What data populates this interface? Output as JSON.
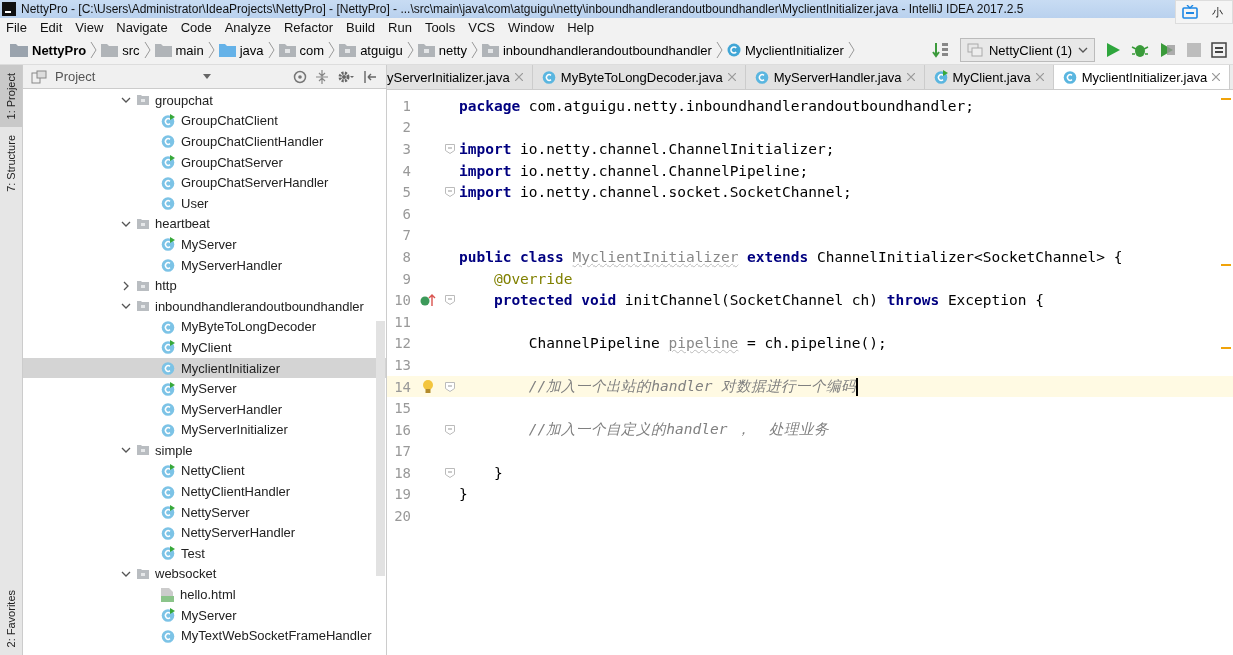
{
  "window": {
    "title": "NettyPro - [C:\\Users\\Administrator\\IdeaProjects\\NettyPro] - [NettyPro] - ...\\src\\main\\java\\com\\atguigu\\netty\\inboundhandlerandoutboundhandler\\MyclientInitializer.java - IntelliJ IDEA 2017.2.5"
  },
  "overlay_widget": {
    "label": "小"
  },
  "menu": [
    "File",
    "Edit",
    "View",
    "Navigate",
    "Code",
    "Analyze",
    "Refactor",
    "Build",
    "Run",
    "Tools",
    "VCS",
    "Window",
    "Help"
  ],
  "breadcrumbs": [
    {
      "label": "NettyPro",
      "kind": "project"
    },
    {
      "label": "src",
      "kind": "folder"
    },
    {
      "label": "main",
      "kind": "folder"
    },
    {
      "label": "java",
      "kind": "source"
    },
    {
      "label": "com",
      "kind": "package"
    },
    {
      "label": "atguigu",
      "kind": "package"
    },
    {
      "label": "netty",
      "kind": "package"
    },
    {
      "label": "inboundhandlerandoutboundhandler",
      "kind": "package"
    },
    {
      "label": "MyclientInitializer",
      "kind": "class"
    }
  ],
  "run_config": {
    "label": "NettyClient (1)"
  },
  "side_tabs": [
    {
      "label": "1: Project",
      "selected": true
    },
    {
      "label": "7: Structure",
      "selected": false
    }
  ],
  "side_tabs_bottom": [
    {
      "label": "2: Favorites",
      "selected": false
    }
  ],
  "project_panel": {
    "title": "Project",
    "tree": [
      {
        "name": "groupchat",
        "expanded": true,
        "selected": false,
        "children": [
          {
            "name": "GroupChatClient",
            "kind": "runnable",
            "selected": false
          },
          {
            "name": "GroupChatClientHandler",
            "kind": "class",
            "selected": false
          },
          {
            "name": "GroupChatServer",
            "kind": "runnable",
            "selected": false
          },
          {
            "name": "GroupChatServerHandler",
            "kind": "class",
            "selected": false
          },
          {
            "name": "User",
            "kind": "class",
            "selected": false
          }
        ]
      },
      {
        "name": "heartbeat",
        "expanded": true,
        "selected": false,
        "children": [
          {
            "name": "MyServer",
            "kind": "runnable",
            "selected": false
          },
          {
            "name": "MyServerHandler",
            "kind": "class",
            "selected": false
          }
        ]
      },
      {
        "name": "http",
        "expanded": false,
        "selected": false
      },
      {
        "name": "inboundhandlerandoutboundhandler",
        "expanded": true,
        "selected": false,
        "children": [
          {
            "name": "MyByteToLongDecoder",
            "kind": "class",
            "selected": false
          },
          {
            "name": "MyClient",
            "kind": "runnable",
            "selected": false
          },
          {
            "name": "MyclientInitializer",
            "kind": "class",
            "selected": true
          },
          {
            "name": "MyServer",
            "kind": "runnable",
            "selected": false
          },
          {
            "name": "MyServerHandler",
            "kind": "class",
            "selected": false
          },
          {
            "name": "MyServerInitializer",
            "kind": "class",
            "selected": false
          }
        ]
      },
      {
        "name": "simple",
        "expanded": true,
        "selected": false,
        "children": [
          {
            "name": "NettyClient",
            "kind": "runnable",
            "selected": false
          },
          {
            "name": "NettyClientHandler",
            "kind": "class",
            "selected": false
          },
          {
            "name": "NettyServer",
            "kind": "runnable",
            "selected": false
          },
          {
            "name": "NettyServerHandler",
            "kind": "class",
            "selected": false
          },
          {
            "name": "Test",
            "kind": "runnable",
            "selected": false
          }
        ]
      },
      {
        "name": "websocket",
        "expanded": true,
        "selected": false,
        "children": [
          {
            "name": "hello.html",
            "kind": "html",
            "selected": false
          },
          {
            "name": "MyServer",
            "kind": "runnable",
            "selected": false
          },
          {
            "name": "MyTextWebSocketFrameHandler",
            "kind": "class",
            "selected": false
          }
        ]
      }
    ]
  },
  "editor_tabs": [
    {
      "label": "yServerInitializer.java",
      "kind": "none",
      "selected": false
    },
    {
      "label": "MyByteToLongDecoder.java",
      "kind": "class",
      "selected": false
    },
    {
      "label": "MyServerHandler.java",
      "kind": "class",
      "selected": false
    },
    {
      "label": "MyClient.java",
      "kind": "runnable",
      "selected": false
    },
    {
      "label": "MyclientInitializer.java",
      "kind": "class",
      "selected": true
    }
  ],
  "code_lines": [
    {
      "number": "1",
      "current": false,
      "fold": false,
      "tokens": [
        {
          "kind": "keyword",
          "text": "package"
        },
        {
          "kind": "plain",
          "text": " com.atguigu.netty.inboundhandlerandoutboundhandler;"
        }
      ]
    },
    {
      "number": "2",
      "current": false,
      "fold": false
    },
    {
      "number": "3",
      "current": false,
      "fold": true,
      "tokens": [
        {
          "kind": "keyword",
          "text": "import"
        },
        {
          "kind": "plain",
          "text": " io.netty.channel.ChannelInitializer;"
        }
      ]
    },
    {
      "number": "4",
      "current": false,
      "fold": false,
      "tokens": [
        {
          "kind": "keyword",
          "text": "import"
        },
        {
          "kind": "plain",
          "text": " io.netty.channel.ChannelPipeline;"
        }
      ]
    },
    {
      "number": "5",
      "current": false,
      "fold": true,
      "tokens": [
        {
          "kind": "keyword",
          "text": "import"
        },
        {
          "kind": "plain",
          "text": " io.netty.channel.socket.SocketChannel;"
        }
      ]
    },
    {
      "number": "6",
      "current": false,
      "fold": false
    },
    {
      "number": "7",
      "current": false,
      "fold": false
    },
    {
      "number": "8",
      "current": false,
      "fold": false,
      "tokens": [
        {
          "kind": "keyword",
          "text": "public class "
        },
        {
          "kind": "unused",
          "text": "MyclientInitializer"
        },
        {
          "kind": "keyword",
          "text": " extends"
        },
        {
          "kind": "plain",
          "text": " ChannelInitializer<SocketChannel> {"
        }
      ]
    },
    {
      "number": "9",
      "current": false,
      "fold": false,
      "tokens": [
        {
          "kind": "annotation",
          "text": "    @Override"
        }
      ]
    },
    {
      "number": "10",
      "current": false,
      "fold": true,
      "gutter_icon": {
        "kind": "override"
      },
      "tokens": [
        {
          "kind": "keyword",
          "text": "    protected void"
        },
        {
          "kind": "plain",
          "text": " initChannel(SocketChannel ch) "
        },
        {
          "kind": "keyword",
          "text": "throws"
        },
        {
          "kind": "plain",
          "text": " Exception {"
        }
      ]
    },
    {
      "number": "11",
      "current": false,
      "fold": false
    },
    {
      "number": "12",
      "current": false,
      "fold": false,
      "tokens": [
        {
          "kind": "plain",
          "text": "        ChannelPipeline "
        },
        {
          "kind": "unused",
          "text": "pipeline"
        },
        {
          "kind": "plain",
          "text": " = ch.pipeline();"
        }
      ]
    },
    {
      "number": "13",
      "current": false,
      "fold": false
    },
    {
      "number": "14",
      "current": true,
      "fold": true,
      "gutter_icon": {
        "kind": "bulb"
      },
      "tokens": [
        {
          "kind": "comment",
          "text": "        //加入一个出站的handler 对数据进行一个编码"
        }
      ]
    },
    {
      "number": "15",
      "current": false,
      "fold": false
    },
    {
      "number": "16",
      "current": false,
      "fold": true,
      "tokens": [
        {
          "kind": "comment",
          "text": "        //加入一个自定义的handler ，  处理业务"
        }
      ]
    },
    {
      "number": "17",
      "current": false,
      "fold": false
    },
    {
      "number": "18",
      "current": false,
      "fold": true,
      "tokens": [
        {
          "kind": "plain",
          "text": "    }"
        }
      ]
    },
    {
      "number": "19",
      "current": false,
      "fold": false,
      "tokens": [
        {
          "kind": "plain",
          "text": "}"
        }
      ]
    },
    {
      "number": "20",
      "current": false,
      "fold": false
    }
  ]
}
